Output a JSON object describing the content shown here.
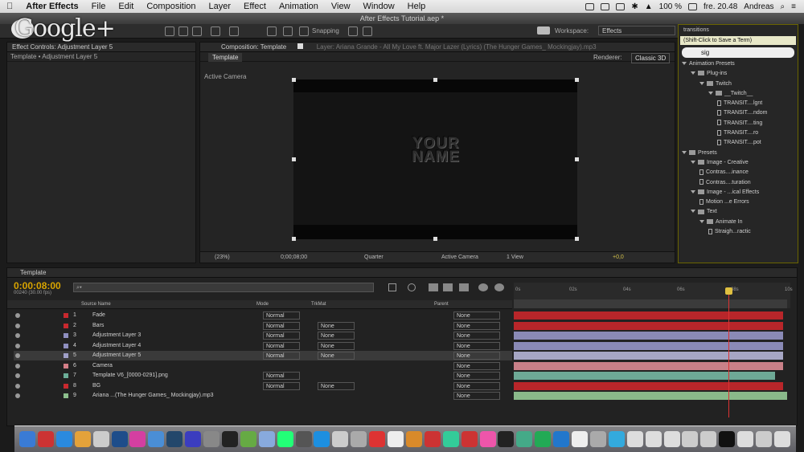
{
  "menubar": {
    "app": "After Effects",
    "items": [
      "File",
      "Edit",
      "Composition",
      "Layer",
      "Effect",
      "Animation",
      "View",
      "Window",
      "Help"
    ],
    "battery": "100 %",
    "clock": "fre. 20.48",
    "user": "Andreas"
  },
  "window_title": "After Effects Tutorial.aep *",
  "watermark": "Google+",
  "toolbar": {
    "snapping": "Snapping",
    "workspace_label": "Workspace:",
    "workspace_value": "Effects"
  },
  "effect_controls": {
    "tab": "Effect Controls: Adjustment Layer 5",
    "breadcrumb": "Template • Adjustment Layer 5"
  },
  "composition": {
    "tab": "Composition: Template",
    "layer_tab": "Layer: Ariana Grande - All My Love ft. Major Lazer (Lyrics) (The Hunger Games_ Mockingjay).mp3",
    "subtab": "Template",
    "renderer_label": "Renderer:",
    "renderer": "Classic 3D",
    "view_label": "Active Camera",
    "canvas_text": [
      "YOUR",
      "NAME"
    ],
    "footer": {
      "zoom": "(23%)",
      "timecode": "0;00;08;00",
      "resolution": "Quarter",
      "camera": "Active Camera",
      "views": "1 View",
      "exposure": "+0,0"
    }
  },
  "presets": {
    "tooltip": "(Shift-Click to Save a Term)",
    "tooltip_top": "transitions",
    "search": "sig",
    "tree": [
      {
        "t": "Animation Presets",
        "lvl": 0,
        "k": "tri"
      },
      {
        "t": "Plug-ins",
        "lvl": 1,
        "k": "folder"
      },
      {
        "t": "Twitch",
        "lvl": 2,
        "k": "folder"
      },
      {
        "t": "__Twitch__",
        "lvl": 3,
        "k": "folder"
      },
      {
        "t": "TRANSIT....lgnt",
        "lvl": 4,
        "k": "file"
      },
      {
        "t": "TRANSIT....ndom",
        "lvl": 4,
        "k": "file"
      },
      {
        "t": "TRANSIT....ting",
        "lvl": 4,
        "k": "file"
      },
      {
        "t": "TRANSIT....ro",
        "lvl": 4,
        "k": "file"
      },
      {
        "t": "TRANSIT....pot",
        "lvl": 4,
        "k": "file"
      },
      {
        "t": "Presets",
        "lvl": 0,
        "k": "folder"
      },
      {
        "t": "Image - Creative",
        "lvl": 1,
        "k": "folder"
      },
      {
        "t": "Contras....inance",
        "lvl": 2,
        "k": "file"
      },
      {
        "t": "Contras....turation",
        "lvl": 2,
        "k": "file"
      },
      {
        "t": "Image - ...ical Effects",
        "lvl": 1,
        "k": "folder"
      },
      {
        "t": "Motion ...e Errors",
        "lvl": 2,
        "k": "file"
      },
      {
        "t": "Text",
        "lvl": 1,
        "k": "folder"
      },
      {
        "t": "Animate In",
        "lvl": 2,
        "k": "folder"
      },
      {
        "t": "Straigh...ractic",
        "lvl": 3,
        "k": "file"
      }
    ]
  },
  "timeline": {
    "tab": "Template",
    "timecode": "0:00:08:00",
    "frames": "00240 (30.00 fps)",
    "search": "⌕▾",
    "ruler": [
      "0s",
      "02s",
      "04s",
      "06s",
      "08s",
      "10s"
    ],
    "columns": {
      "source": "Source Name",
      "mode": "Mode",
      "trkmat": "TrkMat",
      "parent": "Parent"
    },
    "layers": [
      {
        "n": "1",
        "name": "Fade",
        "mode": "Normal",
        "trk": "",
        "parent": "None",
        "label": "#c8292e",
        "bar": "#b8262a"
      },
      {
        "n": "2",
        "name": "Bars",
        "mode": "Normal",
        "trk": "None",
        "parent": "None",
        "label": "#c8292e",
        "bar": "#b8262a"
      },
      {
        "n": "3",
        "name": "Adjustment Layer 3",
        "mode": "Normal",
        "trk": "None",
        "parent": "None",
        "label": "#8f8fbf",
        "bar": "#8a8ab6"
      },
      {
        "n": "4",
        "name": "Adjustment Layer 4",
        "mode": "Normal",
        "trk": "None",
        "parent": "None",
        "label": "#8f8fbf",
        "bar": "#8a8ab6"
      },
      {
        "n": "5",
        "name": "Adjustment Layer 5",
        "mode": "Normal",
        "trk": "None",
        "parent": "None",
        "label": "#a0a0c8",
        "bar": "#a6a6c4"
      },
      {
        "n": "6",
        "name": "Camera",
        "mode": "",
        "trk": "",
        "parent": "None",
        "label": "#d47f88",
        "bar": "#c98088"
      },
      {
        "n": "7",
        "name": "Template V6_[0000-0291].png",
        "mode": "Normal",
        "trk": "",
        "parent": "None",
        "label": "#6cae98",
        "bar": "#6ea996"
      },
      {
        "n": "8",
        "name": "BG",
        "mode": "Normal",
        "trk": "None",
        "parent": "None",
        "label": "#c8292e",
        "bar": "#b8262a"
      },
      {
        "n": "9",
        "name": "Ariana ...(The Hunger Games_ Mockingjay).mp3",
        "mode": "",
        "trk": "",
        "parent": "None",
        "label": "#8dbf8d",
        "bar": "#8ab98a"
      }
    ]
  },
  "dock_count": 42
}
